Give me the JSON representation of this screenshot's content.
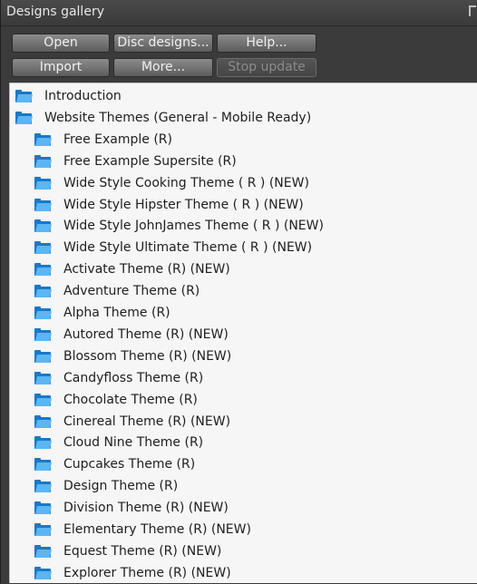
{
  "panel": {
    "title": "Designs gallery"
  },
  "toolbar": {
    "open_label": "Open",
    "disc_designs_label": "Disc designs...",
    "help_label": "Help...",
    "import_label": "Import",
    "more_label": "More...",
    "stop_update_label": "Stop update",
    "stop_update_enabled": false
  },
  "tree": {
    "root_items": [
      {
        "label": "Introduction",
        "icon": "folder-icon"
      },
      {
        "label": "Website Themes (General - Mobile Ready)",
        "icon": "folder-open-icon"
      }
    ],
    "child_items": [
      {
        "label": "Free Example (R)"
      },
      {
        "label": "Free Example Supersite (R)"
      },
      {
        "label": "Wide Style Cooking Theme ( R ) (NEW)"
      },
      {
        "label": "Wide Style Hipster Theme ( R ) (NEW)"
      },
      {
        "label": "Wide Style JohnJames Theme ( R ) (NEW)"
      },
      {
        "label": "Wide Style Ultimate Theme ( R ) (NEW)"
      },
      {
        "label": "Activate Theme (R) (NEW)"
      },
      {
        "label": "Adventure Theme (R)"
      },
      {
        "label": "Alpha Theme (R)"
      },
      {
        "label": "Autored Theme (R) (NEW)"
      },
      {
        "label": "Blossom Theme (R) (NEW)"
      },
      {
        "label": "Candyfloss Theme (R)"
      },
      {
        "label": "Chocolate Theme (R)"
      },
      {
        "label": "Cinereal Theme (R) (NEW)"
      },
      {
        "label": "Cloud Nine Theme (R)"
      },
      {
        "label": "Cupcakes Theme (R)"
      },
      {
        "label": "Design Theme (R)"
      },
      {
        "label": "Division Theme (R) (NEW)"
      },
      {
        "label": "Elementary Theme (R) (NEW)"
      },
      {
        "label": "Equest Theme (R) (NEW)"
      },
      {
        "label": "Explorer Theme (R) (NEW)"
      }
    ]
  },
  "colors": {
    "folder_dark": "#1a78c8",
    "folder_light": "#5cb6f2",
    "panel_bg": "#3b3b3b",
    "list_bg": "#f6f6f6"
  }
}
